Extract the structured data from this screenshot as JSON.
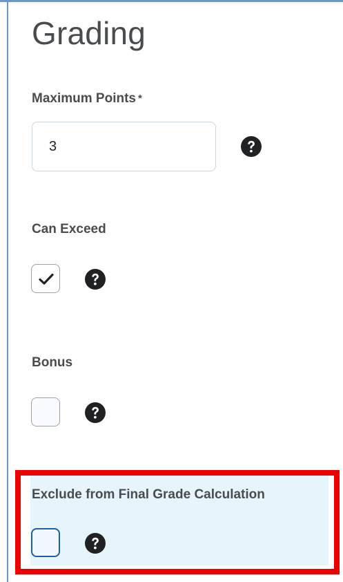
{
  "section": {
    "title": "Grading"
  },
  "maximum_points": {
    "label": "Maximum Points",
    "required_marker": "*",
    "value": "3",
    "help_icon": "question-circle-icon"
  },
  "can_exceed": {
    "label": "Can Exceed",
    "checked": true,
    "help_icon": "question-circle-icon"
  },
  "bonus": {
    "label": "Bonus",
    "checked": false,
    "help_icon": "question-circle-icon"
  },
  "exclude_from_final": {
    "label": "Exclude from Final Grade Calculation",
    "checked": false,
    "focused": true,
    "help_icon": "question-circle-icon"
  },
  "colors": {
    "accent_border": "#6b98c9",
    "highlight_background": "#e6f5fc",
    "annotation_frame": "#ec0000",
    "focus_ring": "#1e5fa6"
  }
}
